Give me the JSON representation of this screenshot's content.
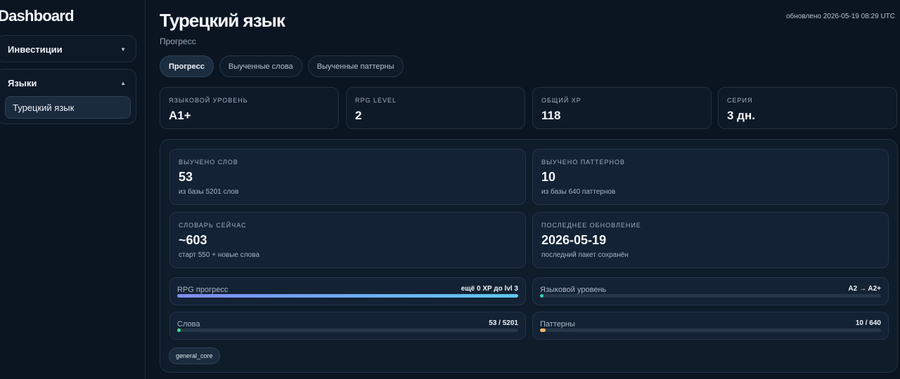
{
  "sidebar": {
    "brand": "Dashboard",
    "groups": [
      {
        "label": "Инвестиции",
        "chevron": "▼"
      },
      {
        "label": "Языки",
        "chevron": "▲",
        "items": [
          {
            "label": "Турецкий язык"
          }
        ]
      }
    ]
  },
  "header": {
    "title": "Турецкий язык",
    "subtitle": "Прогресс",
    "updated": "обновлено 2026-05-19 08:29 UTC"
  },
  "tabs": [
    {
      "label": "Прогресс",
      "active": true
    },
    {
      "label": "Выученные слова",
      "active": false
    },
    {
      "label": "Выученные паттерны",
      "active": false
    }
  ],
  "stats": [
    {
      "label": "ЯЗЫКОВОЙ УРОВЕНЬ",
      "value": "A1+"
    },
    {
      "label": "RPG LEVEL",
      "value": "2"
    },
    {
      "label": "ОБЩИЙ XP",
      "value": "118"
    },
    {
      "label": "СЕРИЯ",
      "value": "3 дн."
    }
  ],
  "cards": [
    {
      "label": "ВЫУЧЕНО СЛОВ",
      "value": "53",
      "note": "из базы 5201 слов"
    },
    {
      "label": "ВЫУЧЕНО ПАТТЕРНОВ",
      "value": "10",
      "note": "из базы 640 паттернов"
    },
    {
      "label": "СЛОВАРЬ СЕЙЧАС",
      "value": "~603",
      "note": "старт 550 + новые слова"
    },
    {
      "label": "ПОСЛЕДНЕЕ ОБНОВЛЕНИЕ",
      "value": "2026-05-19",
      "note": "последний пакет сохранён"
    }
  ],
  "progress": [
    {
      "label": "RPG прогресс",
      "value": "ещё 0 XP до lvl 3",
      "fraction": 1.0,
      "color": "#7f8cf0"
    },
    {
      "label": "Языковой уровень",
      "value": "A2 → A2+",
      "fraction": 0.0,
      "color": "#2fd0b0"
    },
    {
      "label": "Слова",
      "value": "53 / 5201",
      "fraction": 0.0102,
      "color": "#3ee08a"
    },
    {
      "label": "Паттерны",
      "value": "10 / 640",
      "fraction": 0.0156,
      "color": "#f2b36b"
    }
  ],
  "tags": [
    "general_core"
  ],
  "colors": {
    "background": "#0b1522",
    "accent_gradient_start": "#7f8cf0",
    "accent_gradient_end": "#5ec8f0"
  }
}
